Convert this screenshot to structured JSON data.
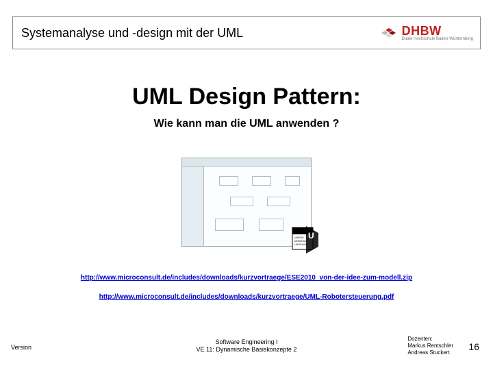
{
  "header": {
    "title": "Systemanalyse und -design mit der UML",
    "logo_text": "DHBW",
    "logo_subtitle": "Duale Hochschule Baden-Württemberg"
  },
  "content": {
    "main_title": "UML Design Pattern:",
    "subtitle": "Wie kann man die UML anwenden ?",
    "uml_badge_lines": [
      "UNIFIED",
      "MODELING",
      "LANGUAGE"
    ]
  },
  "links": {
    "link1": "http://www.microconsult.de/includes/downloads/kurzvortraege/ESE2010_von-der-idee-zum-modell.zip",
    "link2": "http://www.microconsult.de/includes/downloads/kurzvortraege/UML-Robotersteuerung.pdf"
  },
  "footer": {
    "left": "Version",
    "center_line1": "Software Engineering I",
    "center_line2": "VE 11: Dynamische Basiskonzepte 2",
    "right_heading": "Dozenten:",
    "right_line1": "Markus Rentschler",
    "right_line2": "Andreas Stuckert",
    "slide_number": "16"
  },
  "colors": {
    "brand_red": "#c22020",
    "link_blue": "#0000cc"
  }
}
